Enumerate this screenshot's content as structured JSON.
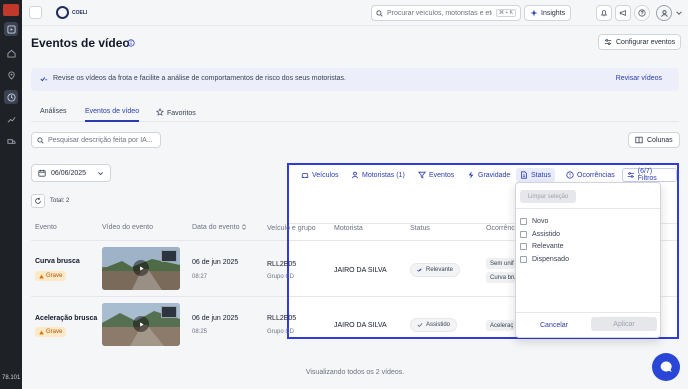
{
  "rail": {
    "logo": "",
    "version": "78.101",
    "items": [
      "video-library",
      "home",
      "location",
      "clock",
      "trend",
      "truck"
    ]
  },
  "topbar": {
    "brand": "COELI",
    "search_placeholder": "Procurar veículos, motoristas e etc...",
    "search_shortcut": "⌘ + K",
    "insights_label": "Insights"
  },
  "header": {
    "title": "Eventos de vídeo",
    "config_label": "Configurar eventos"
  },
  "banner": {
    "text": "Revise os vídeos da frota e facilite a análise de comportamentos de risco dos seus motoristas.",
    "link": "Revisar vídeos"
  },
  "tabs": [
    {
      "label": "Análises",
      "active": false
    },
    {
      "label": "Eventos de vídeo",
      "active": true
    },
    {
      "label": "Favoritos",
      "active": false
    }
  ],
  "filters": {
    "desc_placeholder": "Pesquisar descrição feita por IA...",
    "columns_label": "Colunas",
    "date": "06/06/2025",
    "buttons": {
      "vehicles": "Veículos",
      "drivers": "Motoristas (1)",
      "events": "Eventos",
      "severity": "Gravidade",
      "status": "Status",
      "occurrences": "Ocorrências",
      "filters": "(6/7) Filtros"
    }
  },
  "total_label": "Total: 2",
  "table": {
    "headers": {
      "event": "Evento",
      "video": "Vídeo do evento",
      "date": "Data do evento",
      "vehicle": "Veículo e grupo",
      "driver": "Motorista",
      "status": "Status",
      "occurrences": "Ocorrênc"
    },
    "rows": [
      {
        "event": "Curva brusca",
        "severity": "Grave",
        "date": "06 de jun 2025",
        "time": "08:27",
        "vehicle": "RLL2E05",
        "group": "Grupo CD",
        "driver": "JAIRO DA SILVA",
        "status": "Relevante",
        "occurrences": [
          "Sem unif",
          "Curva bru"
        ]
      },
      {
        "event": "Aceleração brusca",
        "severity": "Grave",
        "date": "06 de jun 2025",
        "time": "08:25",
        "vehicle": "RLL2E05",
        "group": "Grupo CD",
        "driver": "JAIRO DA SILVA",
        "status": "Assistido",
        "occurrences": [
          "Aceleraç"
        ]
      }
    ]
  },
  "dropdown": {
    "clear_label": "Limpar seleção",
    "options": [
      "Novo",
      "Assistido",
      "Relevante",
      "Dispensado"
    ],
    "cancel_label": "Cancelar",
    "apply_label": "Aplicar"
  },
  "footer": "Visualizando todos os 2 vídeos.",
  "colors": {
    "accent": "#2b3cae",
    "highlight_border": "#2f3bdc",
    "rail_bg": "#1e2126",
    "badge_grave": "#fde8c8",
    "chat": "#2a46d6"
  }
}
